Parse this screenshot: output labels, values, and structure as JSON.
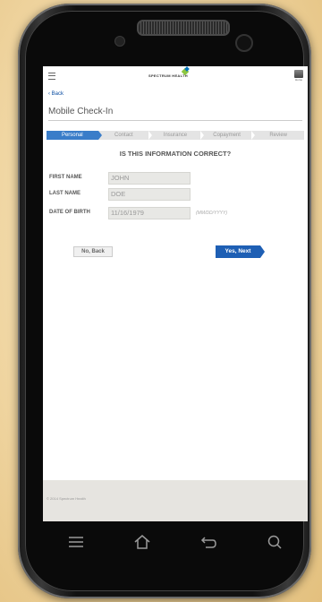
{
  "header": {
    "logo_text": "SPECTRUM HEALTH",
    "home_label": "Home"
  },
  "nav": {
    "back_label": "‹ Back"
  },
  "page": {
    "title": "Mobile Check-In"
  },
  "steps": [
    {
      "label": "Personal",
      "active": true
    },
    {
      "label": "Contact",
      "active": false
    },
    {
      "label": "Insurance",
      "active": false
    },
    {
      "label": "Copayment",
      "active": false
    },
    {
      "label": "Review",
      "active": false
    }
  ],
  "form": {
    "question": "IS THIS INFORMATION CORRECT?",
    "first_name_label": "FIRST NAME",
    "first_name_value": "JOHN",
    "last_name_label": "LAST NAME",
    "last_name_value": "DOE",
    "dob_label": "DATE OF BIRTH",
    "dob_value": "11/16/1979",
    "dob_hint": "(MM/DD/YYYY)"
  },
  "buttons": {
    "back": "No, Back",
    "next": "Yes, Next"
  },
  "footer": {
    "copyright": "© 2014 Spectrum Health"
  },
  "colors": {
    "accent": "#1e5fb4",
    "step_active": "#3a7dc9",
    "brand_green": "#8cc63f"
  },
  "icons": {
    "menu": "hamburger-icon",
    "home": "home-icon",
    "android_nav": [
      "menu-icon",
      "home-icon",
      "back-icon",
      "search-icon"
    ]
  }
}
